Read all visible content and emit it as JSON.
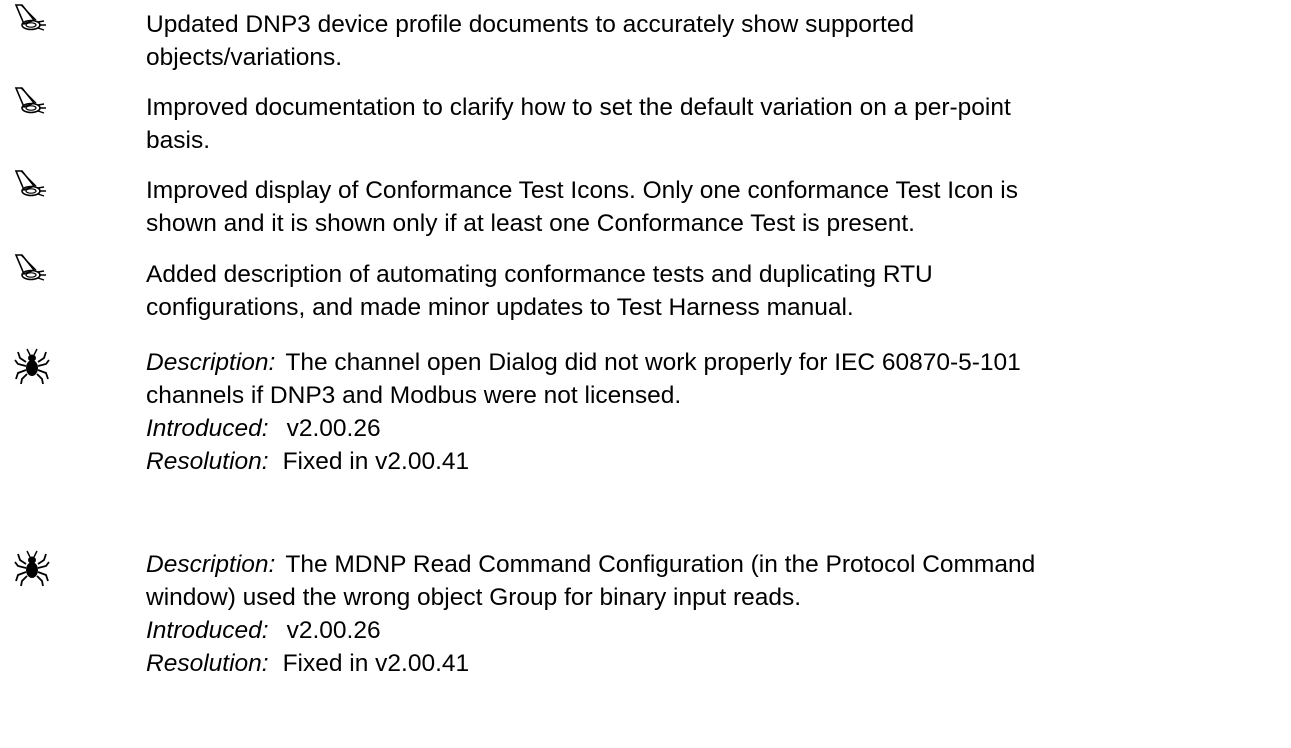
{
  "enhancements": [
    {
      "icon": "megaphone-icon",
      "lines": [
        "Updated DNP3 device profile documents to accurately show supported",
        "objects/variations."
      ]
    },
    {
      "icon": "megaphone-icon",
      "lines": [
        "Improved documentation to clarify how to set the default variation on a per-point",
        "basis."
      ]
    },
    {
      "icon": "megaphone-icon",
      "lines": [
        "Improved display of Conformance Test Icons. Only one conformance Test Icon is",
        "shown and it is shown only if at least one Conformance Test is present."
      ]
    },
    {
      "icon": "megaphone-icon",
      "lines": [
        "Added description of automating conformance tests and duplicating RTU",
        "configurations, and made minor updates to Test Harness manual."
      ]
    }
  ],
  "bugs": [
    {
      "icon": "bug-icon",
      "description_label": "Description:",
      "description_lines": [
        "The channel open Dialog did not work properly for IEC 60870-5-101",
        "channels if DNP3 and Modbus were not licensed."
      ],
      "introduced_label": "Introduced:",
      "introduced_value": "v2.00.26",
      "resolution_label": "Resolution:",
      "resolution_value": "Fixed in v2.00.41"
    },
    {
      "icon": "bug-icon",
      "description_label": "Description:",
      "description_lines": [
        "The MDNP Read Command Configuration (in the Protocol Command",
        "window) used the wrong object Group for binary input reads."
      ],
      "introduced_label": "Introduced:",
      "introduced_value": "v2.00.26",
      "resolution_label": "Resolution:",
      "resolution_value": "Fixed in v2.00.41"
    }
  ]
}
